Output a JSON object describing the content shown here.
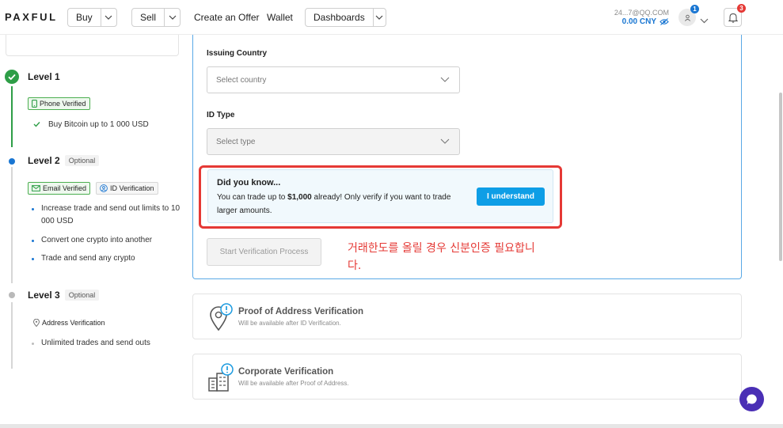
{
  "header": {
    "logo": "PAXFUL",
    "buy_label": "Buy",
    "sell_label": "Sell",
    "create_offer": "Create an Offer",
    "wallet": "Wallet",
    "dashboards_label": "Dashboards",
    "account_email": "24...7@QQ.COM",
    "balance": "0.00 CNY",
    "avatar_badge": "1",
    "notification_badge": "3"
  },
  "sidebar": {
    "level1": {
      "title": "Level 1",
      "chip": "Phone Verified",
      "items": [
        "Buy Bitcoin up to 1 000 USD"
      ]
    },
    "level2": {
      "title": "Level 2",
      "optional": "Optional",
      "chips": [
        "Email Verified",
        "ID Verification"
      ],
      "items": [
        "Increase trade and send out limits to 10 000 USD",
        "Convert one crypto into another",
        "Trade and send any crypto"
      ]
    },
    "level3": {
      "title": "Level 3",
      "optional": "Optional",
      "chip": "Address Verification",
      "items": [
        "Unlimited trades and send outs"
      ]
    }
  },
  "form": {
    "issuing_country_label": "Issuing Country",
    "country_placeholder": "Select country",
    "id_type_label": "ID Type",
    "type_placeholder": "Select type",
    "info_title": "Did you know...",
    "info_text_before": "You can trade up to ",
    "info_amount": "$1,000",
    "info_text_after": " already! Only verify if you want to trade larger amounts.",
    "understand_button": "I understand",
    "start_button": "Start Verification Process",
    "annotation": "거래한도를 올릴 경우 신분인증 필요합니다."
  },
  "cards": [
    {
      "title": "Proof of Address Verification",
      "subtitle": "Will be available after ID Verification.",
      "icon": "location-pin-icon"
    },
    {
      "title": "Corporate Verification",
      "subtitle": "Will be available after Proof of Address.",
      "icon": "building-icon"
    }
  ],
  "colors": {
    "accent_blue": "#0e9ee6",
    "success_green": "#2e9e47",
    "annotation_red": "#e53935",
    "chat_purple": "#4a2fb5"
  }
}
